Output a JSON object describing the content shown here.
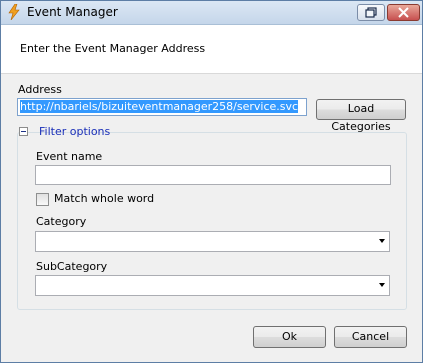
{
  "window": {
    "title": "Event Manager",
    "header_text": "Enter the Event Manager Address"
  },
  "address": {
    "label": "Address",
    "value": "http://nbariels/bizuiteventmanager258/service.svc",
    "load_button": "Load Categories"
  },
  "filter": {
    "legend": "Filter options",
    "event_name_label": "Event name",
    "event_name_value": "",
    "match_whole_word_label": "Match whole word",
    "match_whole_word_checked": false,
    "category_label": "Category",
    "category_value": "",
    "subcategory_label": "SubCategory",
    "subcategory_value": ""
  },
  "footer": {
    "ok_label": "Ok",
    "cancel_label": "Cancel"
  },
  "colors": {
    "selection": "#3399ff",
    "legend_text": "#1a2fb8",
    "window_border": "#5d7ea5"
  }
}
